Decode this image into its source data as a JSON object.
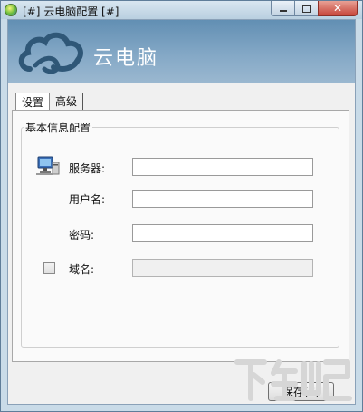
{
  "window": {
    "title": "[#] 云电脑配置 [#]",
    "controls": {
      "minimize": "minimize",
      "maximize": "maximize",
      "close": "close"
    }
  },
  "banner": {
    "title": "云电脑",
    "background_color": "#7aa0c0",
    "logo_icon": "cloud-logo-icon"
  },
  "tabs": [
    {
      "label": "设置",
      "active": true
    },
    {
      "label": "高级",
      "active": false
    }
  ],
  "group": {
    "title": "基本信息配置",
    "fields": {
      "server": {
        "label": "服务器:",
        "value": "",
        "icon": "computer-network-icon"
      },
      "username": {
        "label": "用户名:",
        "value": ""
      },
      "password": {
        "label": "密码:",
        "value": ""
      },
      "domain": {
        "label": "域名:",
        "value": "",
        "checked": false,
        "enabled": false
      }
    }
  },
  "buttons": {
    "save": "保存(S)"
  },
  "watermark": {
    "text": "下载吧"
  }
}
